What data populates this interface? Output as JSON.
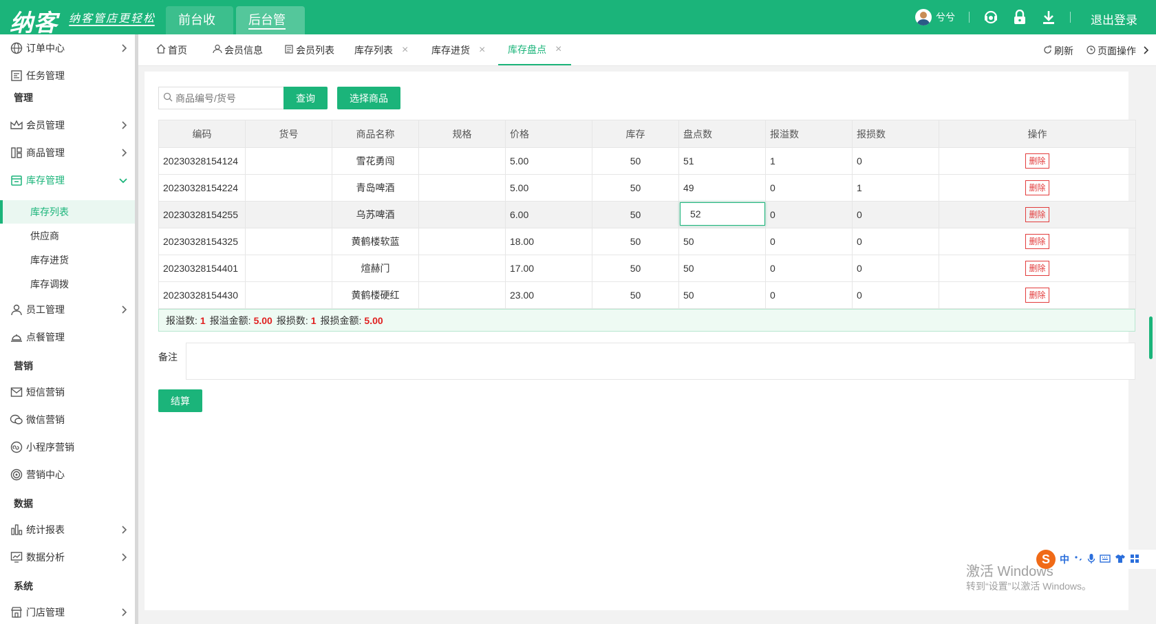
{
  "topbar": {
    "logo": "纳客",
    "slogan": "纳客管店更轻松",
    "nav": [
      "前台收银",
      "后台管理"
    ],
    "user_name": "兮兮",
    "logout": "退出登录"
  },
  "sidebar": {
    "items": [
      {
        "label": "订单中心",
        "icon": "globe-icon"
      },
      {
        "label": "任务管理",
        "icon": "task-icon"
      },
      {
        "group": "管理"
      },
      {
        "label": "会员管理",
        "icon": "crown-icon"
      },
      {
        "label": "商品管理",
        "icon": "goods-icon"
      },
      {
        "label": "库存管理",
        "icon": "inventory-icon"
      },
      {
        "label": "员工管理",
        "icon": "user-icon"
      },
      {
        "label": "点餐管理",
        "icon": "dining-icon"
      },
      {
        "group": "营销"
      },
      {
        "label": "短信营销",
        "icon": "mail-icon"
      },
      {
        "label": "微信营销",
        "icon": "wechat-icon"
      },
      {
        "label": "小程序营销",
        "icon": "miniapp-icon"
      },
      {
        "label": "营销中心",
        "icon": "target-icon"
      },
      {
        "group": "数据"
      },
      {
        "label": "统计报表",
        "icon": "bar-chart-icon"
      },
      {
        "label": "数据分析",
        "icon": "monitor-chart-icon"
      },
      {
        "group": "系统"
      },
      {
        "label": "门店管理",
        "icon": "store-icon"
      }
    ],
    "inventory_sub": [
      "库存列表",
      "供应商",
      "库存进货",
      "库存调拨"
    ]
  },
  "tabs": [
    {
      "label": "首页"
    },
    {
      "label": "会员信息"
    },
    {
      "label": "会员列表"
    },
    {
      "label": "库存列表"
    },
    {
      "label": "库存进货"
    },
    {
      "label": "库存盘点"
    }
  ],
  "tab_actions": {
    "refresh": "刷新",
    "page_ops": "页面操作"
  },
  "search": {
    "placeholder": "商品编号/货号",
    "query_btn": "查询",
    "select_btn": "选择商品"
  },
  "table": {
    "headers": [
      "编码",
      "货号",
      "商品名称",
      "规格",
      "价格",
      "库存",
      "盘点数",
      "报溢数",
      "报损数",
      "操作"
    ],
    "delete_label": "删除",
    "rows": [
      {
        "code": "20230328154124",
        "sku": "",
        "name": "雪花勇闯",
        "spec": "",
        "price": "5.00",
        "stock": "50",
        "count": "51",
        "overflow": "1",
        "loss": "0"
      },
      {
        "code": "20230328154224",
        "sku": "",
        "name": "青岛啤酒",
        "spec": "",
        "price": "5.00",
        "stock": "50",
        "count": "49",
        "overflow": "0",
        "loss": "1"
      },
      {
        "code": "20230328154255",
        "sku": "",
        "name": "乌苏啤酒",
        "spec": "",
        "price": "6.00",
        "stock": "50",
        "count": "52",
        "overflow": "0",
        "loss": "0"
      },
      {
        "code": "20230328154325",
        "sku": "",
        "name": "黄鹤楼软蓝",
        "spec": "",
        "price": "18.00",
        "stock": "50",
        "count": "50",
        "overflow": "0",
        "loss": "0"
      },
      {
        "code": "20230328154401",
        "sku": "",
        "name": "煊赫门",
        "spec": "",
        "price": "17.00",
        "stock": "50",
        "count": "50",
        "overflow": "0",
        "loss": "0"
      },
      {
        "code": "20230328154430",
        "sku": "",
        "name": "黄鹤楼硬红",
        "spec": "",
        "price": "23.00",
        "stock": "50",
        "count": "50",
        "overflow": "0",
        "loss": "0"
      }
    ]
  },
  "summary": {
    "overflow_label": "报溢数:",
    "overflow_count": "1",
    "overflow_amount_label": "报溢金额:",
    "overflow_amount": "5.00",
    "loss_label": "报损数:",
    "loss_count": "1",
    "loss_amount_label": "报损金额:",
    "loss_amount": "5.00"
  },
  "remark_label": "备注",
  "settle_btn": "结算",
  "watermark": {
    "line1": "激活 Windows",
    "line2": "转到“设置”以激活 Windows。"
  },
  "ime": {
    "mode": "中"
  },
  "colors": {
    "brand": "#1bb47a",
    "danger": "#e23b3b"
  }
}
